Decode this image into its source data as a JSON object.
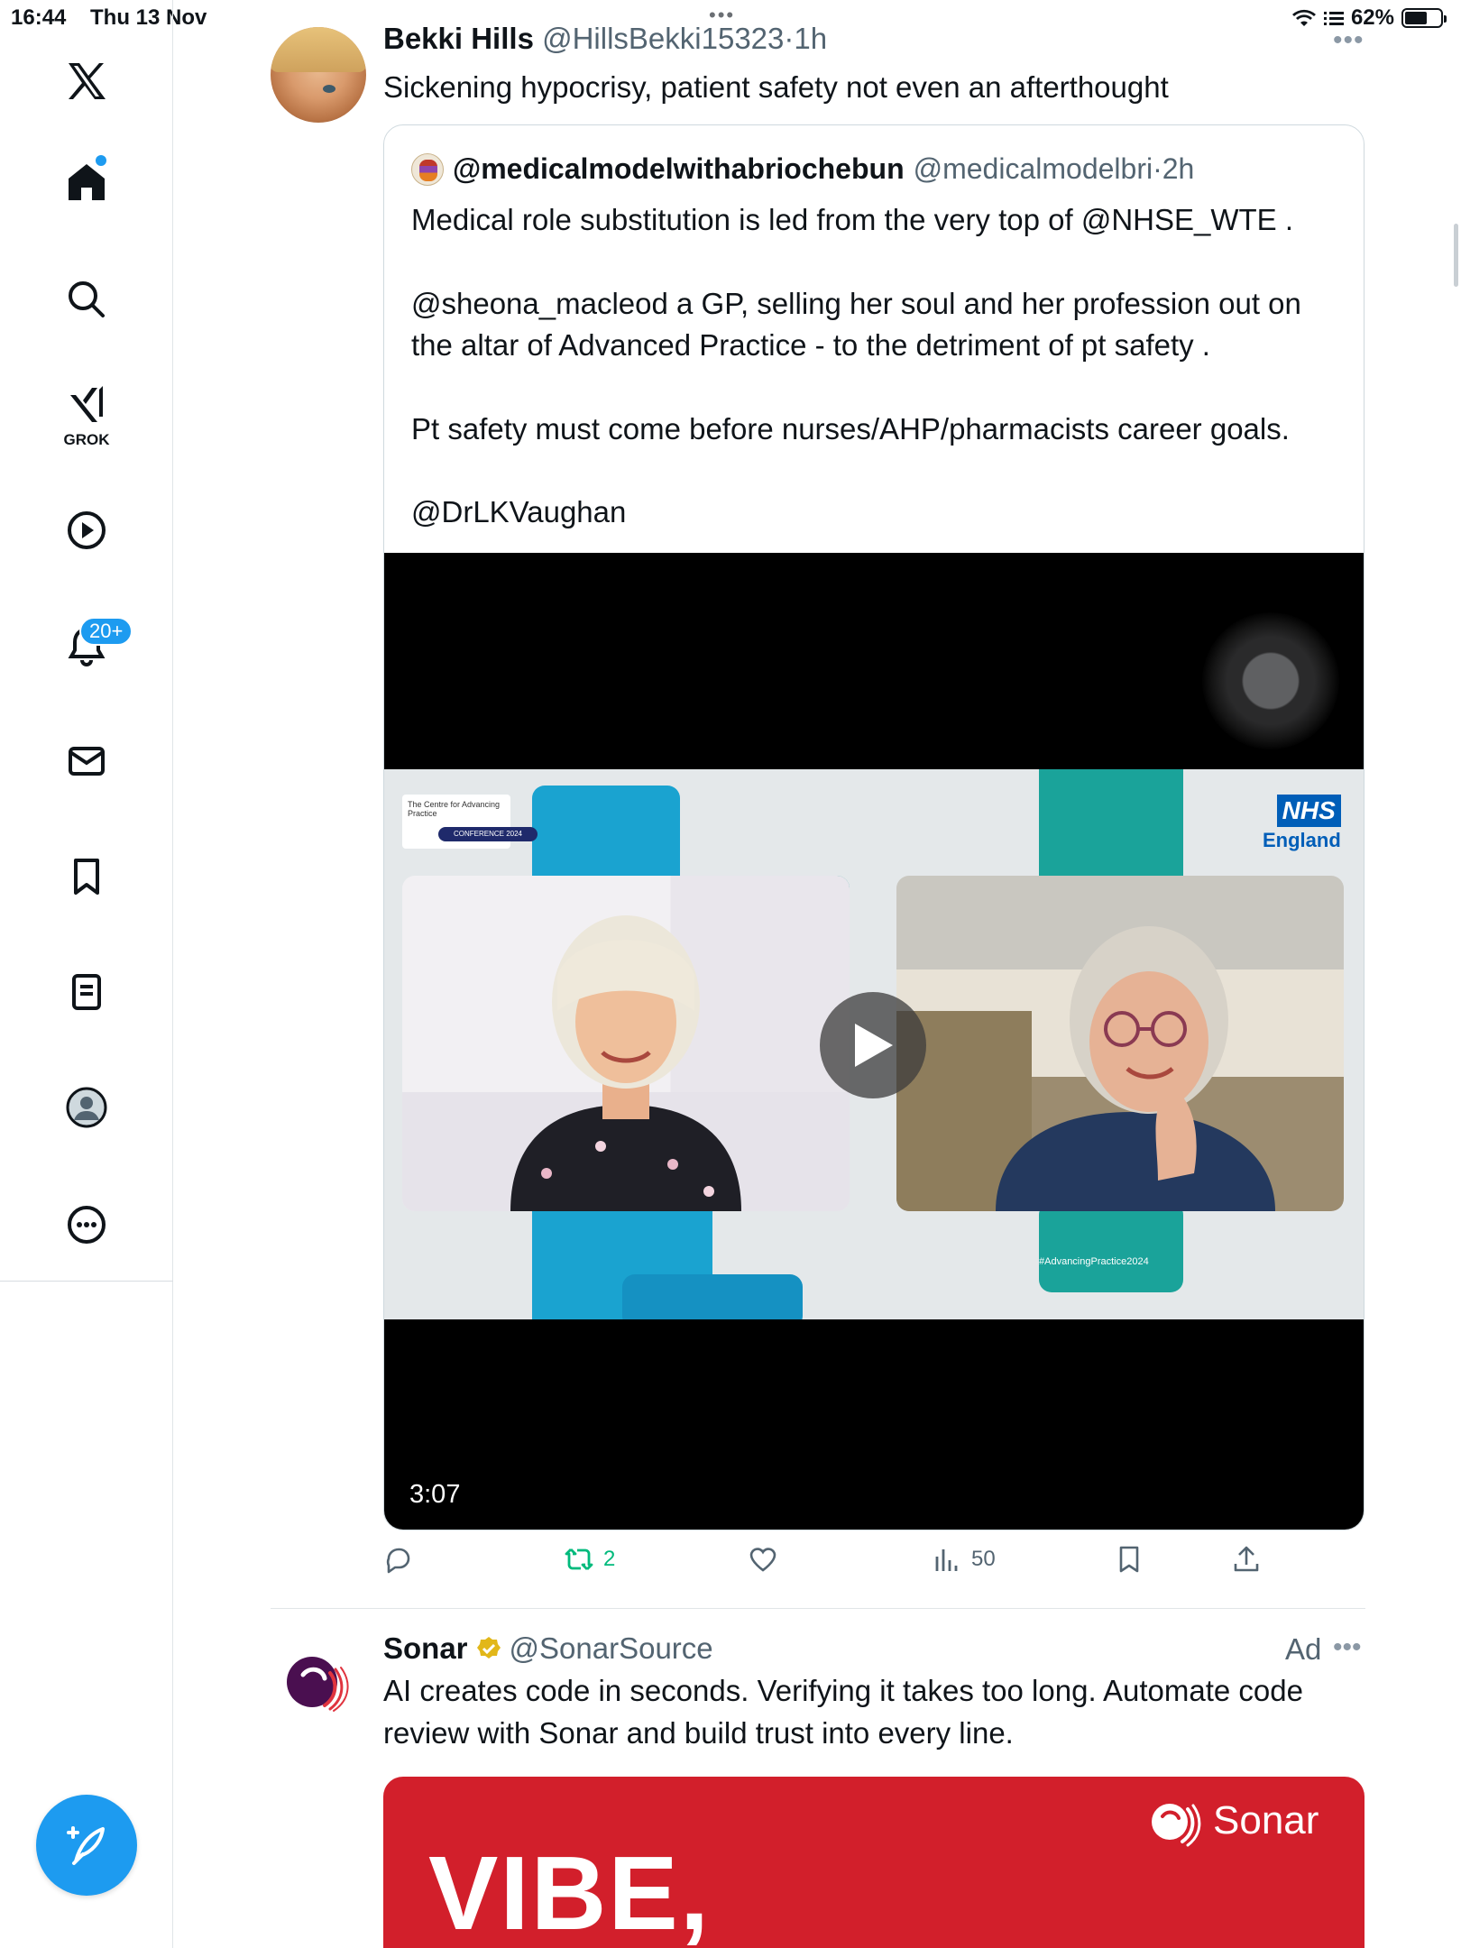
{
  "status_bar": {
    "time": "16:44",
    "date": "Thu 13 Nov",
    "battery": "62%",
    "battery_level": 0.62
  },
  "sidebar": {
    "items": [
      {
        "name": "x-logo"
      },
      {
        "name": "home"
      },
      {
        "name": "search"
      },
      {
        "name": "grok",
        "label": "GROK"
      },
      {
        "name": "video"
      },
      {
        "name": "notifications",
        "badge": "20+"
      },
      {
        "name": "messages"
      },
      {
        "name": "bookmarks"
      },
      {
        "name": "lists"
      },
      {
        "name": "profile"
      },
      {
        "name": "more"
      }
    ],
    "compose_icon": "feather-plus-icon"
  },
  "post": {
    "author_name": "Bekki Hills",
    "author_handle": "@HillsBekki15323",
    "separator": "·",
    "time": "1h",
    "text": "Sickening hypocrisy, patient safety not even an afterthought",
    "quote": {
      "author_name": "@medicalmodelwithabriochebun",
      "author_handle": "@medicalmodelbri",
      "time": "2h",
      "lines": [
        "Medical role substitution is led from the very top of @NHSE_WTE .",
        "@sheona_macleod a GP, selling her soul and her profession out on",
        "the altar of Advanced Practice - to the detriment of pt safety .",
        "Pt safety must come before nurses/AHP/pharmacists career goals.",
        "@DrLKVaughan"
      ],
      "video": {
        "duration": "3:07",
        "overlay_logo_title": "The Centre for Advancing Practice",
        "overlay_logo_pill": "CONFERENCE 2024",
        "nhs_logo": "NHS",
        "nhs_region": "England",
        "hashtag": "#AdvancingPractice2024"
      }
    },
    "actions": {
      "reposts": "2",
      "views": "50"
    }
  },
  "ad": {
    "author_name": "Sonar",
    "author_handle": "@SonarSource",
    "label": "Ad",
    "lines": [
      "AI creates code in seconds. Verifying it takes too long. Automate code",
      "review with Sonar and build trust into every line."
    ],
    "banner_headline": "VIBE,",
    "banner_brand": "Sonar"
  },
  "colors": {
    "accent": "#1d9bf0",
    "repost_green": "#00ba7c",
    "ad_banner_red": "#d21f2b"
  }
}
